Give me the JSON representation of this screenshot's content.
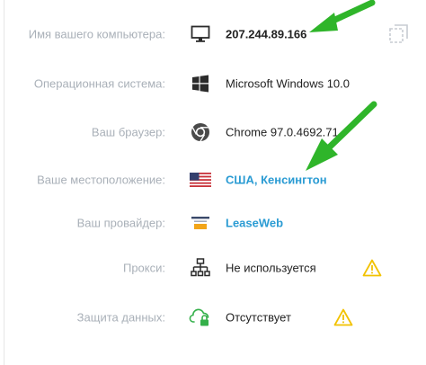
{
  "rows": [
    {
      "label": "Имя вашего компьютера:",
      "value": "207.244.89.166",
      "icon": "monitor-icon"
    },
    {
      "label": "Операционная система:",
      "value": "Microsoft Windows 10.0",
      "icon": "windows-logo-icon"
    },
    {
      "label": "Ваш браузер:",
      "value": "Chrome 97.0.4692.71",
      "icon": "chrome-logo-icon"
    },
    {
      "label": "Ваше местоположение:",
      "value": "США, Кенсингтон",
      "icon": "us-flag-icon"
    },
    {
      "label": "Ваш провайдер:",
      "value": "LeaseWeb",
      "icon": "provider-logo-icon"
    },
    {
      "label": "Прокси:",
      "value": "Не используется",
      "icon": "network-icon",
      "warning": true
    },
    {
      "label": "Защита данных:",
      "value": "Отсутствует",
      "icon": "cloud-lock-icon",
      "warning": true
    }
  ],
  "colors": {
    "label": "#a9b0b8",
    "value": "#222222",
    "link": "#2a9bd3",
    "warning": "#f2c200",
    "arrow": "#2fb52a",
    "icon": "#2b2b2b"
  },
  "icons": {
    "copy": "copy-icon",
    "warning": "warning-icon",
    "annotation": "green-arrow"
  }
}
